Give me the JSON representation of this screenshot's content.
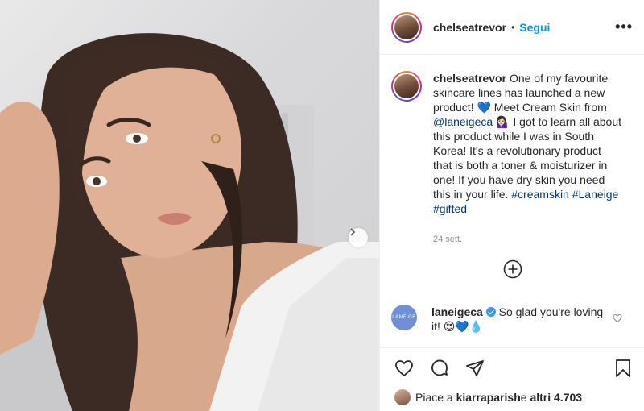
{
  "post": {
    "username": "chelseatrevor",
    "separator": "•",
    "follow_label": "Segui",
    "more_label": "•••"
  },
  "caption": {
    "username": "chelseatrevor",
    "part1": " One of my favourite skincare lines has launched a new product! ",
    "emoji1": "💙",
    "part2": " Meet Cream Skin from ",
    "mention": "@laneigeca",
    "emoji2": " 💁🏻‍♀️",
    "part3": " I got to learn all about this product while I was in South Korea! It's a revolutionary product that is both a toner & moisturizer in one! If you have dry skin you need this in your life. ",
    "hashtags": "#creamskin #Laneige #gifted",
    "time": "24 sett."
  },
  "comment": {
    "avatar_text": "LANEIGE",
    "username": "laneigeca",
    "text": " So glad you're loving it! 😍💙💧"
  },
  "likes": {
    "prefix": "Piace a ",
    "user": "kiarraparish",
    "middle": " e ",
    "others": "altri 4.703"
  },
  "icons": {
    "next": "chevron-right-icon",
    "add_comment": "plus-circle-icon",
    "comment_like": "heart-outline-icon",
    "like": "heart-icon",
    "comment": "comment-icon",
    "share": "paper-plane-icon",
    "save": "bookmark-icon"
  },
  "colors": {
    "link_blue": "#0095f6",
    "hashtag_blue": "#00376b",
    "brand_avatar": "#6f8fd6"
  }
}
